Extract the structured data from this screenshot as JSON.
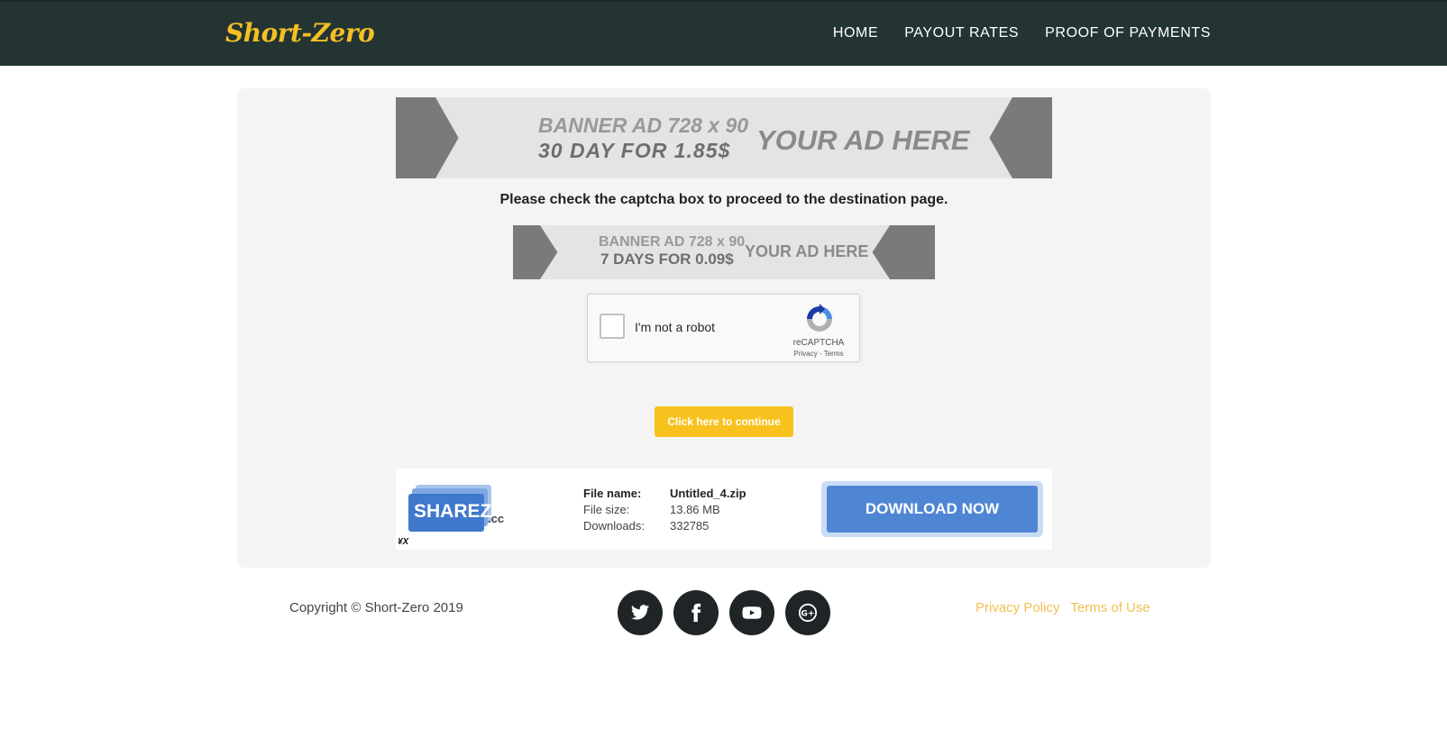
{
  "header": {
    "logo": "Short-Zero",
    "nav": [
      "HOME",
      "PAYOUT RATES",
      "PROOF OF PAYMENTS"
    ]
  },
  "ads": {
    "top": {
      "line1": "BANNER AD 728 x 90",
      "line2": "30  DAY  FOR  1.85$",
      "cta": "YOUR AD HERE"
    },
    "middle": {
      "line1": "BANNER AD 728 x 90",
      "line2": "7 DAYS FOR 0.09$",
      "cta": "YOUR AD HERE"
    }
  },
  "instruction": "Please check the captcha box to proceed to the destination page.",
  "recaptcha": {
    "label": "I'm not a robot",
    "brand": "reCAPTCHA",
    "links": "Privacy - Terms",
    "icon": "recaptcha-logo-icon"
  },
  "continue_label": "Click here to continue",
  "file": {
    "logo_text": "SHAREZ",
    "logo_suffix": ".cc",
    "corner_mark": "¥X",
    "rows": [
      {
        "key": "File name:",
        "value": "Untitled_4.zip"
      },
      {
        "key": "File size:",
        "value": "13.86 MB"
      },
      {
        "key": "Downloads:",
        "value": "332785"
      }
    ],
    "download_label": "DOWNLOAD NOW"
  },
  "footer": {
    "copyright": "Copyright © Short-Zero 2019",
    "socials": [
      "twitter-icon",
      "facebook-icon",
      "youtube-icon",
      "google-plus-icon"
    ],
    "links": [
      "Privacy Policy",
      "Terms of Use"
    ]
  },
  "colors": {
    "header_bg": "#243433",
    "accent": "#f5c024",
    "download": "#4f86d4"
  }
}
